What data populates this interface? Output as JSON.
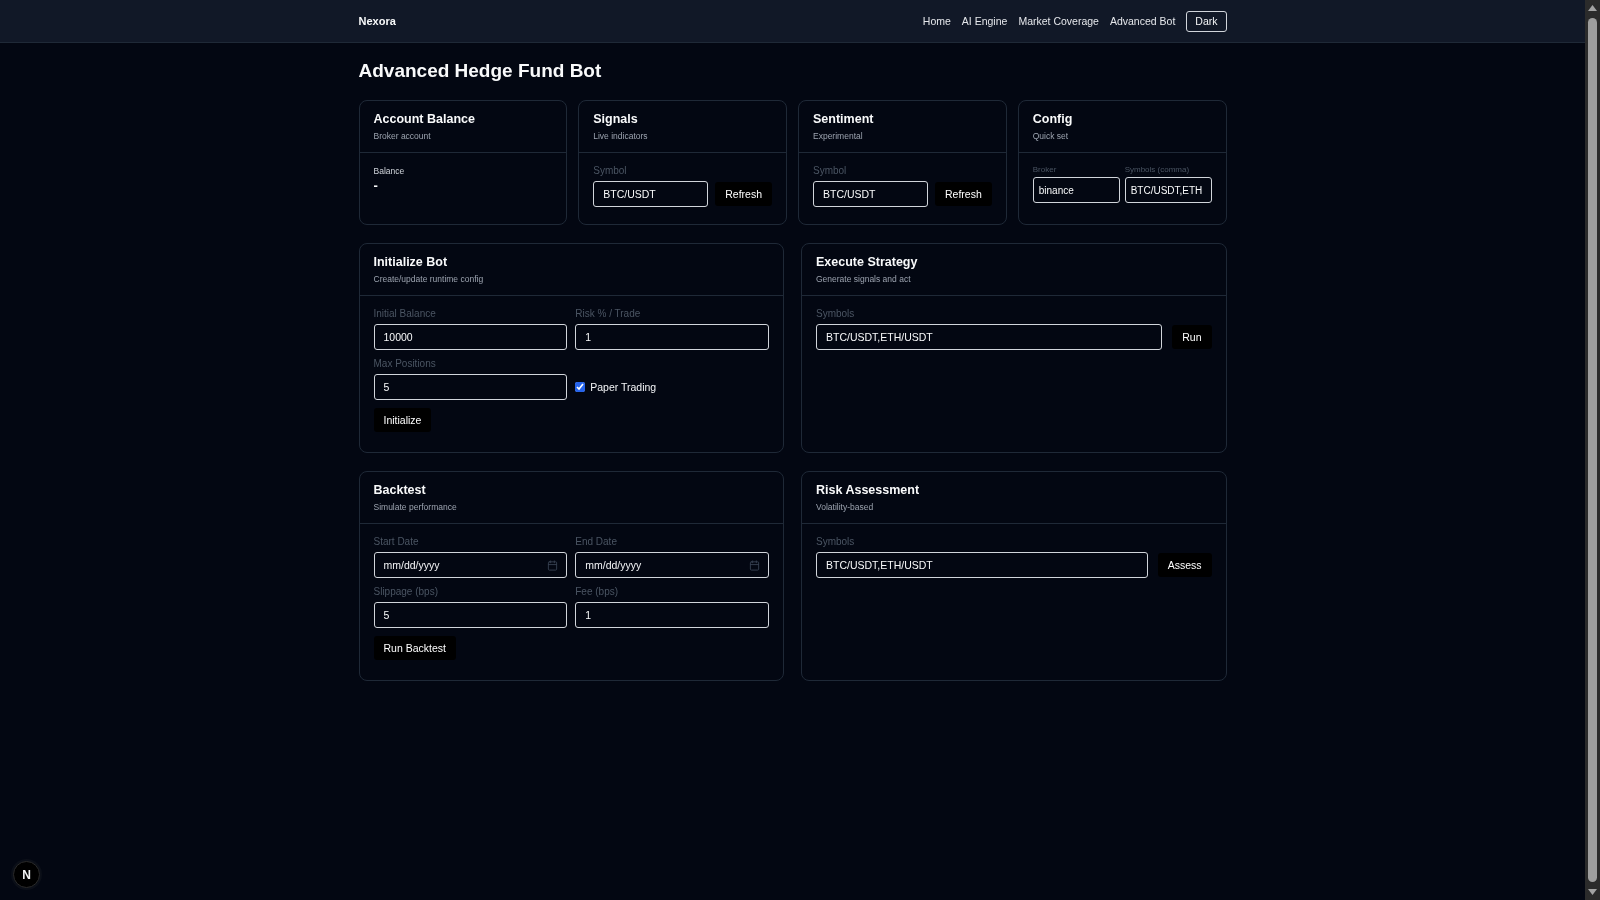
{
  "nav": {
    "brand": "Nexora",
    "links": [
      {
        "label": "Home"
      },
      {
        "label": "AI Engine"
      },
      {
        "label": "Market Coverage"
      },
      {
        "label": "Advanced Bot"
      }
    ],
    "theme_button": "Dark"
  },
  "page_title": "Advanced Hedge Fund Bot",
  "top_cards": [
    {
      "kind": "balance",
      "title": "Account Balance",
      "subtitle": "Broker account",
      "label": "Balance",
      "value": "-"
    },
    {
      "kind": "symbol",
      "title": "Signals",
      "subtitle": "Live indicators",
      "label": "Symbol",
      "value": "BTC/USDT",
      "button": "Refresh"
    },
    {
      "kind": "symbol",
      "title": "Sentiment",
      "subtitle": "Experimental",
      "label": "Symbol",
      "value": "BTC/USDT",
      "button": "Refresh"
    },
    {
      "kind": "config",
      "title": "Config",
      "subtitle": "Quick set",
      "fields": [
        {
          "label": "Broker",
          "value": "binance"
        },
        {
          "label": "Symbols (comma)",
          "value": "BTC/USDT,ETH"
        }
      ]
    }
  ],
  "panels": [
    {
      "kind": "form",
      "title": "Initialize Bot",
      "subtitle": "Create/update runtime config",
      "fields": [
        {
          "kind": "text",
          "label": "Initial Balance",
          "value": "10000"
        },
        {
          "kind": "text",
          "label": "Risk % / Trade",
          "value": "1"
        },
        {
          "kind": "text",
          "label": "Max Positions",
          "value": "5"
        },
        {
          "kind": "checkbox",
          "label": "Paper Trading",
          "checked": true
        }
      ],
      "button": "Initialize"
    },
    {
      "kind": "symbols",
      "title": "Execute Strategy",
      "subtitle": "Generate signals and act",
      "label": "Symbols",
      "value": "BTC/USDT,ETH/USDT",
      "button": "Run"
    },
    {
      "kind": "form",
      "title": "Backtest",
      "subtitle": "Simulate performance",
      "fields": [
        {
          "kind": "date",
          "label": "Start Date",
          "placeholder": "mm/dd/yyyy"
        },
        {
          "kind": "date",
          "label": "End Date",
          "placeholder": "mm/dd/yyyy"
        },
        {
          "kind": "text",
          "label": "Slippage (bps)",
          "value": "5"
        },
        {
          "kind": "text",
          "label": "Fee (bps)",
          "value": "1"
        }
      ],
      "button": "Run Backtest"
    },
    {
      "kind": "symbols",
      "title": "Risk Assessment",
      "subtitle": "Volatility-based",
      "label": "Symbols",
      "value": "BTC/USDT,ETH/USDT",
      "button": "Assess"
    }
  ],
  "dev_badge": "N"
}
